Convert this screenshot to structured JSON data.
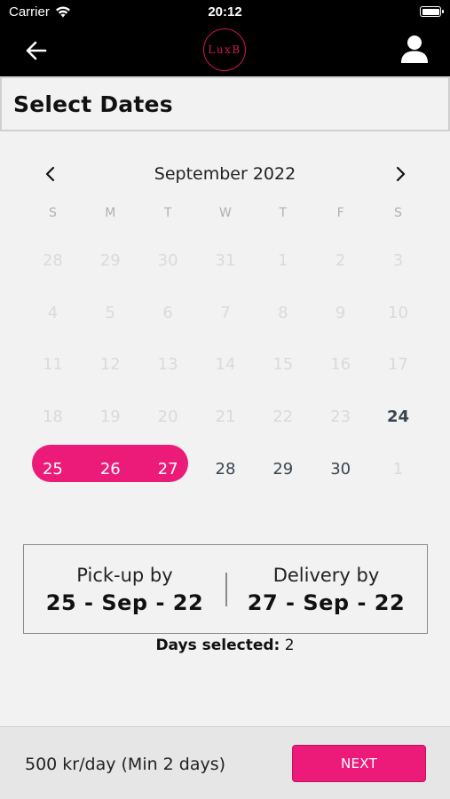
{
  "status_bar": {
    "carrier": "Carrier",
    "time": "20:12"
  },
  "nav": {
    "logo_text": "LuxB",
    "back_icon": "arrow-left-icon",
    "profile_icon": "person-icon"
  },
  "page": {
    "title": "Select Dates"
  },
  "calendar": {
    "month_label": "September 2022",
    "weekdays": [
      "S",
      "M",
      "T",
      "W",
      "T",
      "F",
      "S"
    ],
    "weeks": [
      [
        "28",
        "29",
        "30",
        "31",
        "1",
        "2",
        "3"
      ],
      [
        "4",
        "5",
        "6",
        "7",
        "8",
        "9",
        "10"
      ],
      [
        "11",
        "12",
        "13",
        "14",
        "15",
        "16",
        "17"
      ],
      [
        "18",
        "19",
        "20",
        "21",
        "22",
        "23",
        "24"
      ],
      [
        "25",
        "26",
        "27",
        "28",
        "29",
        "30",
        "1"
      ]
    ],
    "colors": {
      "accent": "#ec1a78",
      "disabled": "#dadada",
      "enabled": "#3a4450"
    }
  },
  "summary": {
    "pickup_label": "Pick-up by",
    "pickup_value": "25 - Sep - 22",
    "delivery_label": "Delivery by",
    "delivery_value": "27 - Sep - 22",
    "days_selected_label": "Days selected:",
    "days_selected_value": "2"
  },
  "footer": {
    "price_text": "500 kr/day (Min 2 days)",
    "next_label": "NEXT"
  }
}
